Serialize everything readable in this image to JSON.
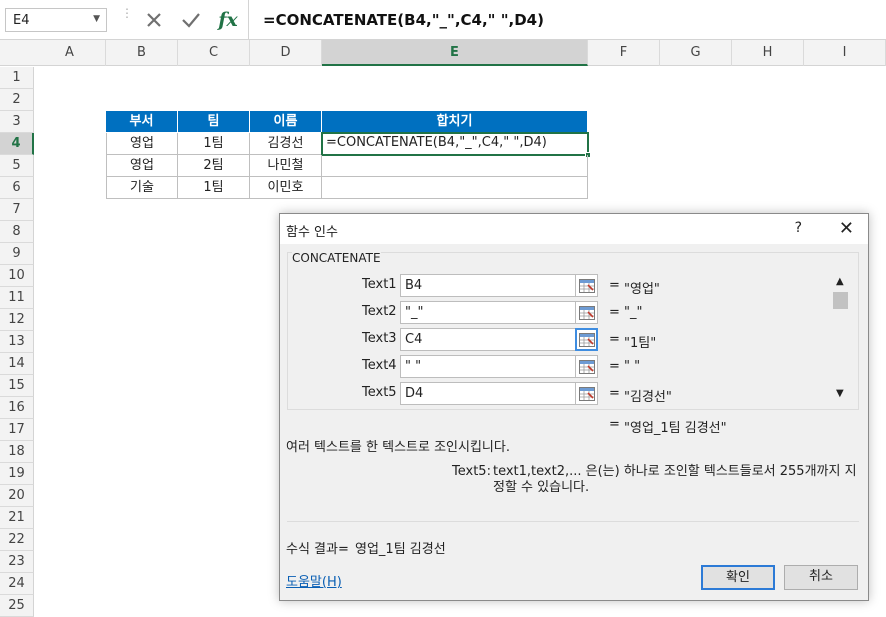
{
  "formula_bar": {
    "name_box": "E4",
    "cancel_icon": "x-icon",
    "enter_icon": "check-icon",
    "function_icon_label": "fx",
    "formula": "=CONCATENATE(B4,\"_\",C4,\" \",D4)"
  },
  "columns": [
    "A",
    "B",
    "C",
    "D",
    "E",
    "F",
    "G",
    "H",
    "I"
  ],
  "active_column": "E",
  "rows": [
    "1",
    "2",
    "3",
    "4",
    "5",
    "6",
    "7",
    "8",
    "9",
    "10",
    "11",
    "12",
    "13",
    "14",
    "15",
    "16",
    "17",
    "18",
    "19",
    "20",
    "21",
    "22",
    "23",
    "24",
    "25"
  ],
  "active_row": "4",
  "table": {
    "headers": [
      "부서",
      "팀",
      "이름",
      "합치기"
    ],
    "rows": [
      [
        "영업",
        "1팀",
        "김경선",
        "=CONCATENATE(B4,\"_\",C4,\" \",D4)"
      ],
      [
        "영업",
        "2팀",
        "나민철",
        ""
      ],
      [
        "기술",
        "1팀",
        "이민호",
        ""
      ]
    ]
  },
  "colors": {
    "header_fill": "#0070c0",
    "header_text": "#ffffff",
    "excel_green": "#217346"
  },
  "dialog": {
    "title": "함수 인수",
    "help_glyph": "?",
    "close_glyph": "✕",
    "function_name": "CONCATENATE",
    "args": [
      {
        "label": "Text1",
        "value": "B4",
        "eq": "=",
        "result": "\"영업\""
      },
      {
        "label": "Text2",
        "value": "\"_\"",
        "eq": "=",
        "result": "\"_\""
      },
      {
        "label": "Text3",
        "value": "C4",
        "eq": "=",
        "result": "\"1팀\""
      },
      {
        "label": "Text4",
        "value": "\" \"",
        "eq": "=",
        "result": "\" \""
      },
      {
        "label": "Text5",
        "value": "D4",
        "eq": "=",
        "result": "\"김경선\""
      }
    ],
    "total_eq": "=",
    "total_result": "\"영업_1팀 김경선\"",
    "description": "여러 텍스트를 한 텍스트로 조인시킵니다.",
    "arg_desc_label": "Text5:",
    "arg_desc": "text1,text2,... 은(는) 하나로 조인할 텍스트들로서 255개까지 지정할 수 있습니다.",
    "result_label": "수식 결과=",
    "result_value": "영업_1팀 김경선",
    "help_link": "도움말(H)",
    "ok": "확인",
    "cancel": "취소"
  }
}
